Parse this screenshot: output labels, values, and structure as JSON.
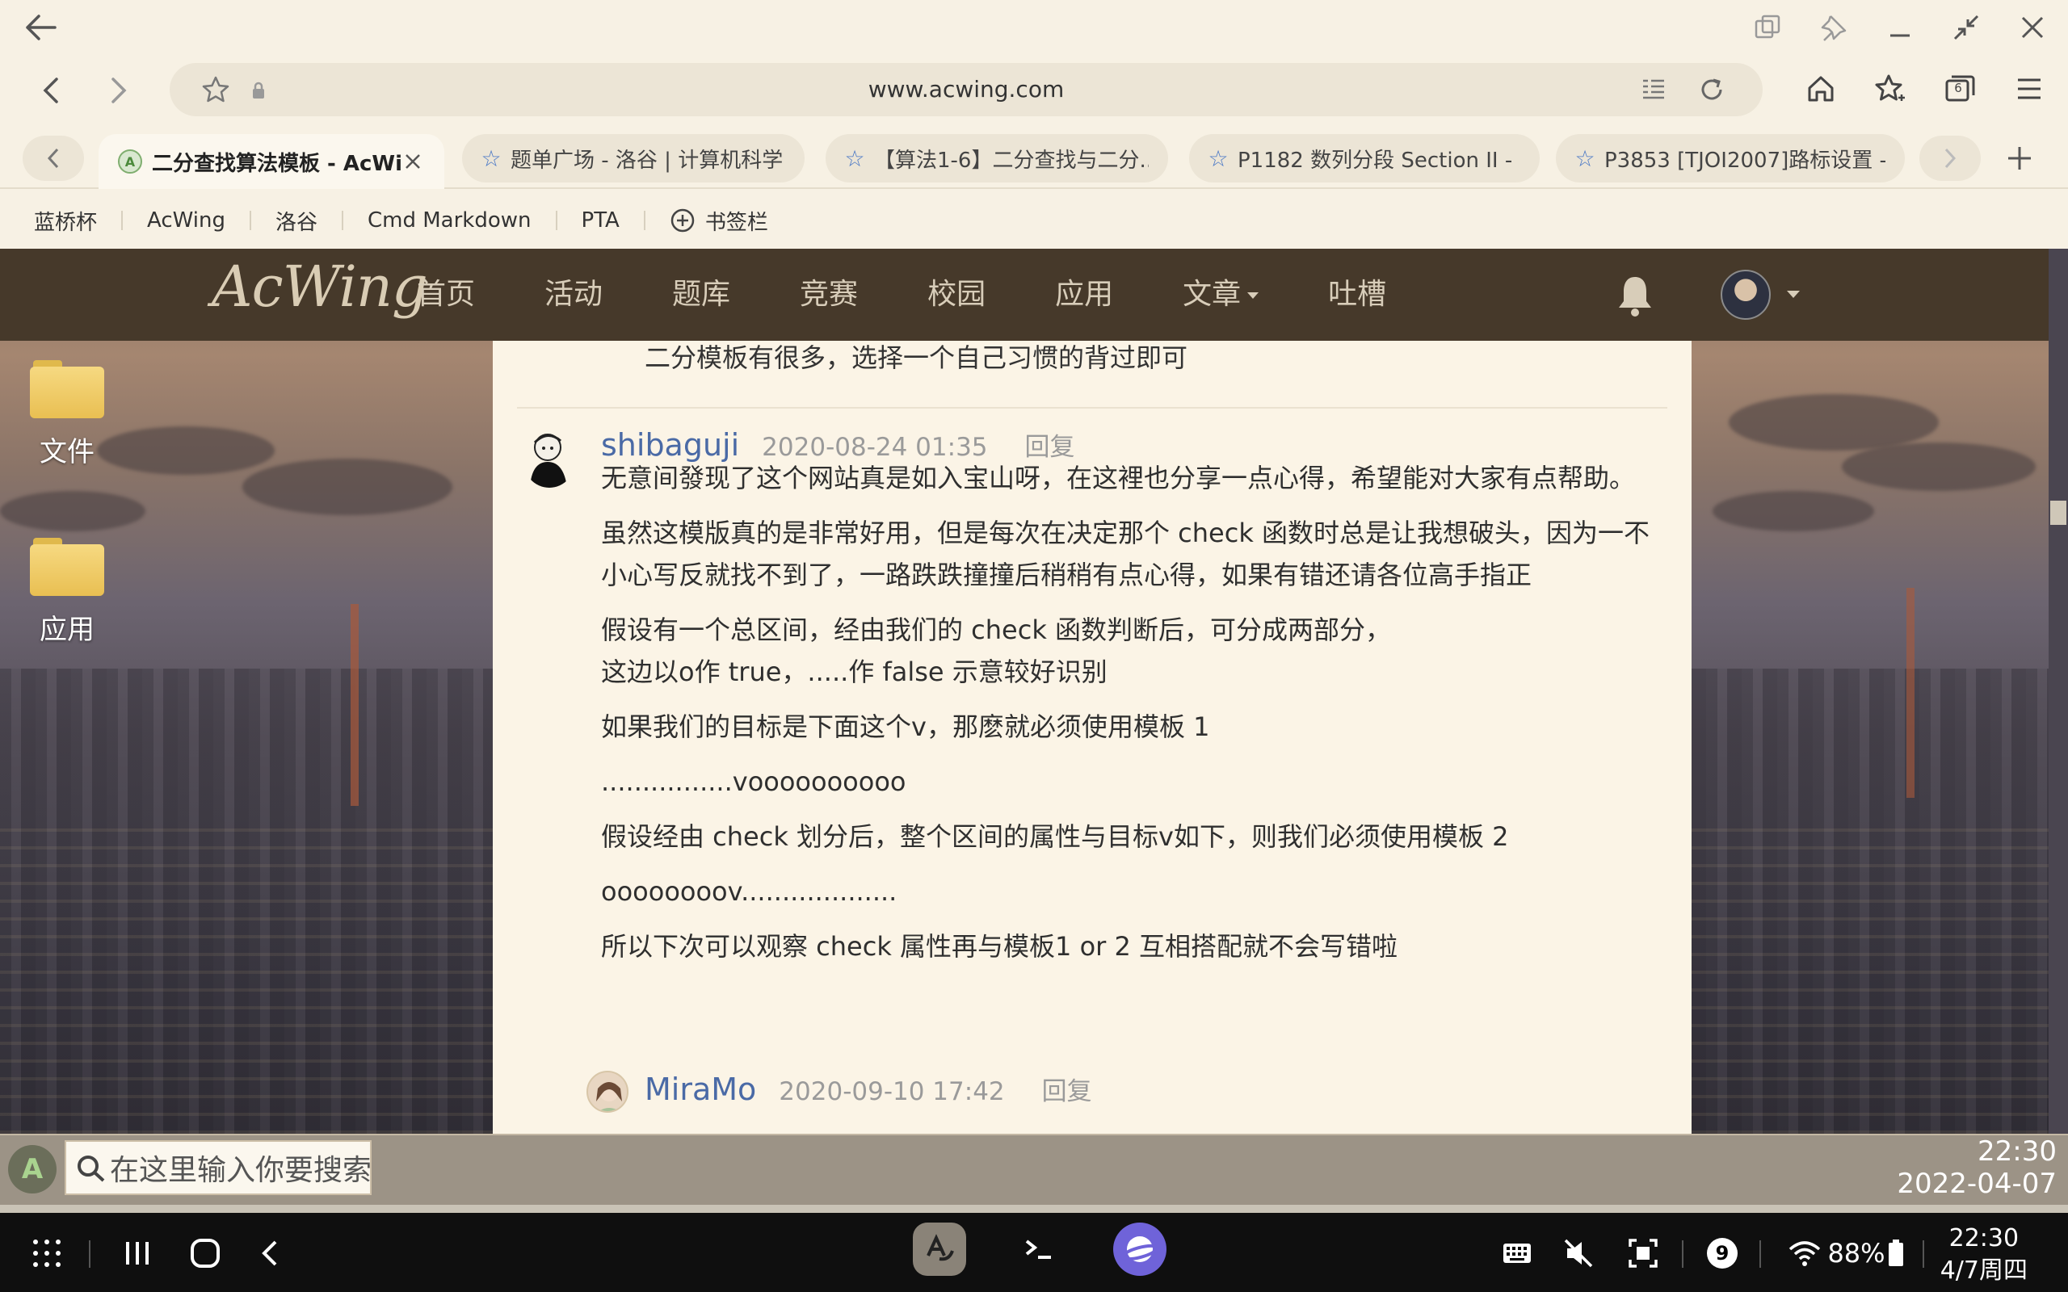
{
  "browser": {
    "url": "www.acwing.com",
    "tab_count": "6",
    "tabs": [
      {
        "title": "二分查找算法模板 - AcWi...",
        "active": true,
        "favicon": "acwing"
      },
      {
        "title": "题单广场 - 洛谷 | 计算机科学...",
        "active": false,
        "favicon": "luogu"
      },
      {
        "title": "【算法1-6】二分查找与二分...",
        "active": false,
        "favicon": "luogu"
      },
      {
        "title": "P1182 数列分段 Section II - ...",
        "active": false,
        "favicon": "luogu"
      },
      {
        "title": "P3853 [TJOI2007]路标设置 - ...",
        "active": false,
        "favicon": "luogu"
      }
    ],
    "bookmarks": [
      "蓝桥杯",
      "AcWing",
      "洛谷",
      "Cmd Markdown",
      "PTA"
    ],
    "bookmark_add_label": "书签栏"
  },
  "site": {
    "logo": "AcWing",
    "nav": [
      "首页",
      "活动",
      "题库",
      "竞赛",
      "校园",
      "应用",
      "文章",
      "吐槽"
    ]
  },
  "desktop": {
    "icons": [
      {
        "label": "文件"
      },
      {
        "label": "应用"
      }
    ]
  },
  "content": {
    "prev_text": "二分模板有很多，选择一个自己习惯的背过即可",
    "comment": {
      "user": "shibaguji",
      "time": "2020-08-24 01:35",
      "reply": "回复",
      "paragraphs": [
        "无意间發现了这个网站真是如入宝山呀，在这裡也分享一点心得，希望能对大家有点帮助。",
        "虽然这模版真的是非常好用，但是每次在决定那个 check 函数时总是让我想破头，因为一不小心写反就找不到了，一路跌跌撞撞后稍稍有点心得，如果有错还请各位高手指正",
        "假设有一个总区间，经由我们的 check 函数判断后，可分成两部分，",
        "这边以o作 true，.....作 false 示意较好识别",
        "如果我们的目标是下面这个v，那麽就必须使用模板 1",
        "................voooooooooo",
        "假设经由 check 划分后，整个区间的属性与目标v如下，则我们必须使用模板 2",
        "oooooooov...................",
        "所以下次可以观察 check 属性再与模板1 or 2 互相搭配就不会写错啦"
      ]
    },
    "next_comment": {
      "user": "MiraMo",
      "time": "2020-09-10 17:42",
      "reply": "回复"
    }
  },
  "dock": {
    "search_placeholder": "在这里输入你要搜索的",
    "time": "22:30",
    "date": "2022-04-07"
  },
  "system": {
    "notification_count": "9",
    "battery": "88%",
    "time": "22:30",
    "date": "4/7周四"
  }
}
